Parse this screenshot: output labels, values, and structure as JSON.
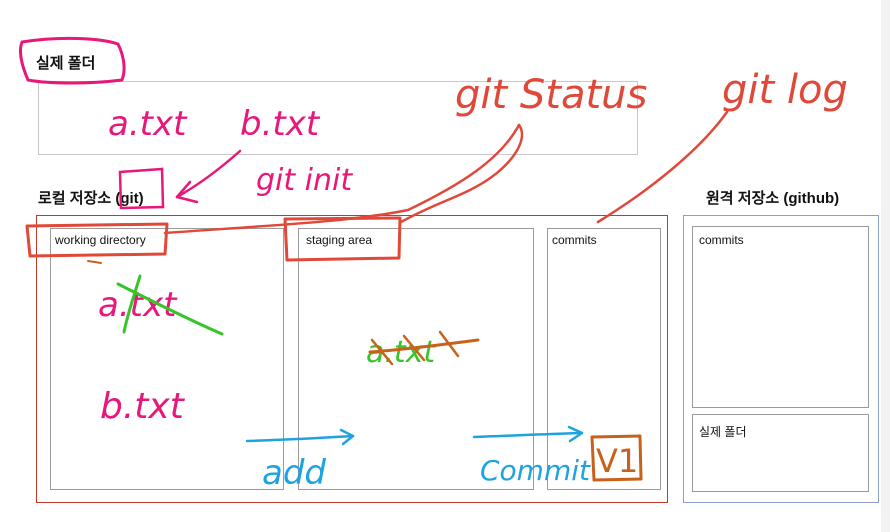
{
  "headings": {
    "real_folder": "실제 폴더",
    "local_repo": "로컬 저장소 (git)",
    "remote_repo": "원격 저장소 (github)"
  },
  "boxes": {
    "working_directory": "working directory",
    "staging_area": "staging area",
    "commits": "commits",
    "remote_commits": "commits",
    "remote_real_folder": "실제 폴더"
  },
  "annotations": {
    "real_a": "a.txt",
    "real_b": "b.txt",
    "git_init": "git init",
    "git_status": "git Status",
    "git_log": "git log",
    "wd_a": "a.txt",
    "wd_b": "b.txt",
    "staged_a": "a.txt",
    "add": "add",
    "commit": "Commit",
    "v1": "V1"
  },
  "colors": {
    "magenta": "#e8177a",
    "red": "#e0483a",
    "green": "#36c42a",
    "orange": "#c8621b",
    "blue": "#1fa3e0",
    "local_border": "#c0392b",
    "remote_border": "#8aa0c8",
    "box_border": "#9a9a9a"
  }
}
